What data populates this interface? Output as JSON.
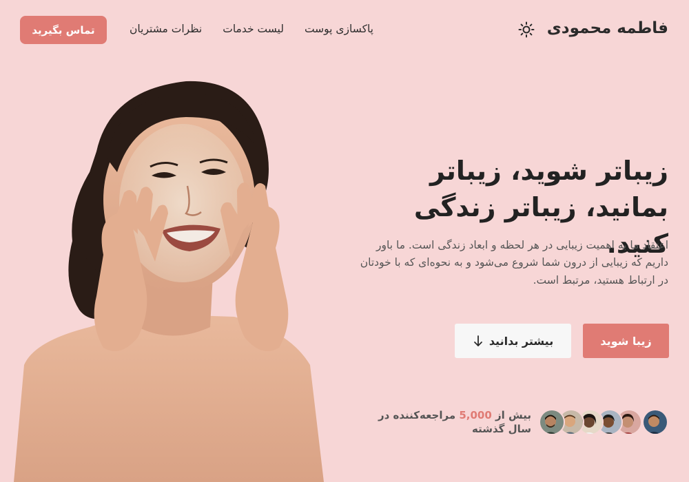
{
  "brand": {
    "name": "فاطمه محمودی"
  },
  "nav": {
    "links": [
      "پاکسازی پوست",
      "لیست خدمات",
      "نظرات مشتریان"
    ],
    "contact_label": "تماس بگیرید"
  },
  "hero": {
    "title": "زیباتر شوید، زیباتر بمانید، زیباتر زندگی کنید.",
    "description": "اعتقاد ما به اهمیت زیبایی در هر لحظه و ابعاد زندگی است. ما باور داریم که زیبایی از درون شما شروع می‌شود و به نحوه‌ای که با خودتان در ارتباط هستید، مرتبط است.",
    "primary_cta": "زیبا شوید",
    "secondary_cta": "بیشتر بدانید"
  },
  "social_proof": {
    "prefix": "بیش از ",
    "count": "5,000",
    "suffix": " مراجعه‌کننده در سال گذشته"
  },
  "icons": {
    "theme_toggle": "sun-icon",
    "secondary_cta": "arrow-down-icon"
  },
  "colors": {
    "background": "#f7d6d6",
    "accent": "#e07b74",
    "text": "#2b2b2b"
  }
}
